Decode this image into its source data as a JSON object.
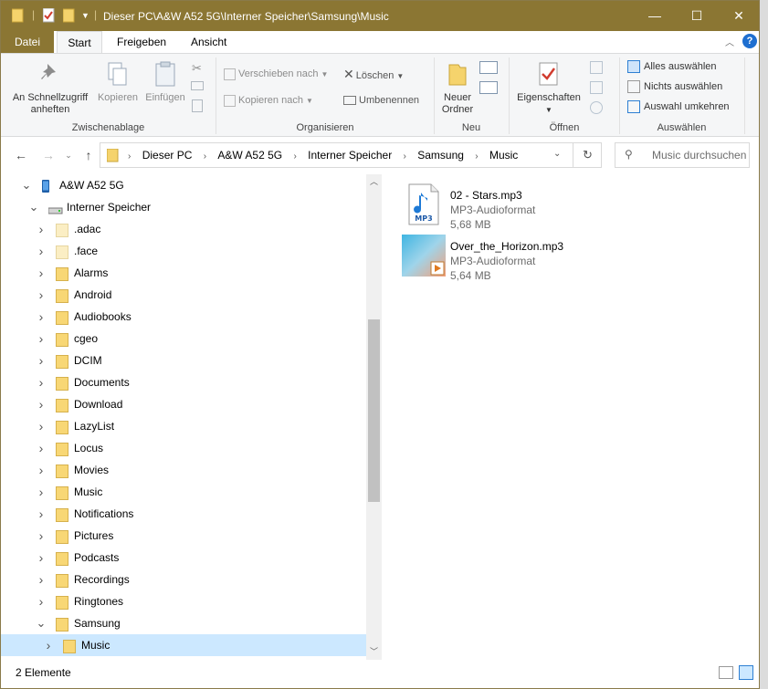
{
  "window": {
    "title": "Dieser PC\\A&W A52 5G\\Interner Speicher\\Samsung\\Music",
    "minimize": "—",
    "maximize": "☐",
    "close": "✕"
  },
  "ribbon_tabs": [
    "Datei",
    "Start",
    "Freigeben",
    "Ansicht"
  ],
  "ribbon": {
    "clipboard": {
      "pin_label": "An Schnellzugriff anheften",
      "copy_label": "Kopieren",
      "paste_label": "Einfügen",
      "group_label": "Zwischenablage"
    },
    "organize": {
      "move_label": "Verschieben nach",
      "copyto_label": "Kopieren nach",
      "delete_label": "Löschen",
      "rename_label": "Umbenennen",
      "group_label": "Organisieren"
    },
    "new": {
      "newfolder_label": "Neuer Ordner",
      "group_label": "Neu"
    },
    "open": {
      "properties_label": "Eigenschaften",
      "group_label": "Öffnen"
    },
    "select": {
      "selectall_label": "Alles auswählen",
      "selectnone_label": "Nichts auswählen",
      "invert_label": "Auswahl umkehren",
      "group_label": "Auswählen"
    }
  },
  "address": {
    "crumbs": [
      "Dieser PC",
      "A&W A52 5G",
      "Interner Speicher",
      "Samsung",
      "Music"
    ],
    "search_placeholder": "Music durchsuchen"
  },
  "tree": [
    {
      "label": "A&W A52 5G",
      "level": 1,
      "expanded": true,
      "icon": "phone-icon"
    },
    {
      "label": "Interner Speicher",
      "level": 2,
      "expanded": true,
      "icon": "drive-icon"
    },
    {
      "label": ".adac",
      "level": 3,
      "expanded": false,
      "icon": "folder-icon",
      "faded": true
    },
    {
      "label": ".face",
      "level": 3,
      "expanded": false,
      "icon": "folder-icon",
      "faded": true
    },
    {
      "label": "Alarms",
      "level": 3,
      "expanded": false,
      "icon": "folder-icon"
    },
    {
      "label": "Android",
      "level": 3,
      "expanded": false,
      "icon": "folder-icon"
    },
    {
      "label": "Audiobooks",
      "level": 3,
      "expanded": false,
      "icon": "folder-icon"
    },
    {
      "label": "cgeo",
      "level": 3,
      "expanded": false,
      "icon": "folder-icon"
    },
    {
      "label": "DCIM",
      "level": 3,
      "expanded": false,
      "icon": "folder-icon"
    },
    {
      "label": "Documents",
      "level": 3,
      "expanded": false,
      "icon": "folder-icon"
    },
    {
      "label": "Download",
      "level": 3,
      "expanded": false,
      "icon": "folder-icon"
    },
    {
      "label": "LazyList",
      "level": 3,
      "expanded": false,
      "icon": "folder-icon"
    },
    {
      "label": "Locus",
      "level": 3,
      "expanded": false,
      "icon": "folder-icon"
    },
    {
      "label": "Movies",
      "level": 3,
      "expanded": false,
      "icon": "folder-icon"
    },
    {
      "label": "Music",
      "level": 3,
      "expanded": false,
      "icon": "folder-icon"
    },
    {
      "label": "Notifications",
      "level": 3,
      "expanded": false,
      "icon": "folder-icon"
    },
    {
      "label": "Pictures",
      "level": 3,
      "expanded": false,
      "icon": "folder-icon"
    },
    {
      "label": "Podcasts",
      "level": 3,
      "expanded": false,
      "icon": "folder-icon"
    },
    {
      "label": "Recordings",
      "level": 3,
      "expanded": false,
      "icon": "folder-icon"
    },
    {
      "label": "Ringtones",
      "level": 3,
      "expanded": false,
      "icon": "folder-icon"
    },
    {
      "label": "Samsung",
      "level": 3,
      "expanded": true,
      "icon": "folder-icon"
    },
    {
      "label": "Music",
      "level": 4,
      "expanded": false,
      "icon": "folder-icon",
      "selected": true
    }
  ],
  "files": [
    {
      "name": "02 - Stars.mp3",
      "type": "MP3-Audioformat",
      "size": "5,68 MB",
      "thumb": "mp3-icon"
    },
    {
      "name": "Over_the_Horizon.mp3",
      "type": "MP3-Audioformat",
      "size": "5,64 MB",
      "thumb": "album-art"
    }
  ],
  "status": {
    "count_text": "2 Elemente"
  },
  "colors": {
    "titlebar": "#8b7633",
    "selection": "#cce8ff",
    "folder": "#f8d775"
  }
}
